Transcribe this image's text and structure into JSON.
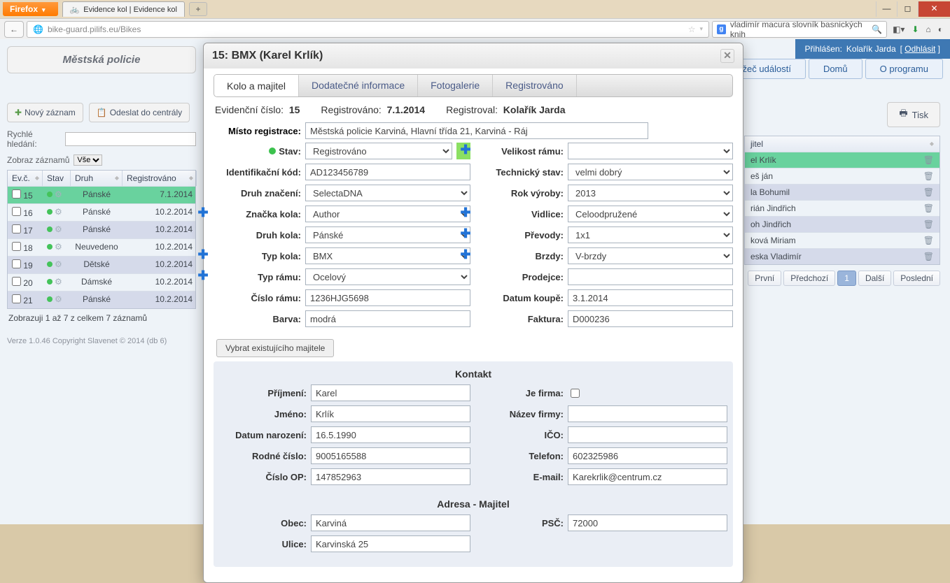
{
  "browser": {
    "firefox": "Firefox",
    "tab_title": "Evidence kol | Evidence kol",
    "url": "bike-guard.pilifs.eu/Bikes",
    "search_text": "vladimír macura slovník basnických knih"
  },
  "header": {
    "logged_in_label": "Přihlášen:",
    "user": "Kolařík Jarda",
    "logout": "Odhlásit",
    "nav": {
      "events": "hlížeč událostí",
      "home": "Domů",
      "about": "O programu"
    }
  },
  "left": {
    "title": "Městská policie",
    "new_record": "Nový záznam",
    "send_central": "Odeslat do centrály",
    "quick_search_label": "Rychlé hledání:",
    "show_records_label": "Zobraz záznamů",
    "show_records_value": "Vše",
    "cols": {
      "evc": "Ev.č.",
      "stav": "Stav",
      "druh": "Druh",
      "reg": "Registrováno"
    },
    "rows": [
      {
        "n": "15",
        "druh": "Pánské",
        "date": "7.1.2014",
        "sel": true
      },
      {
        "n": "16",
        "druh": "Pánské",
        "date": "10.2.2014"
      },
      {
        "n": "17",
        "druh": "Pánské",
        "date": "10.2.2014",
        "alt": true
      },
      {
        "n": "18",
        "druh": "Neuvedeno",
        "date": "10.2.2014"
      },
      {
        "n": "19",
        "druh": "Dětské",
        "date": "10.2.2014",
        "alt": true
      },
      {
        "n": "20",
        "druh": "Dámské",
        "date": "10.2.2014"
      },
      {
        "n": "21",
        "druh": "Pánské",
        "date": "10.2.2014",
        "alt": true
      }
    ],
    "footer": "Zobrazuji 1 až 7 z celkem 7 záznamů",
    "version": "Verze 1.0.46 Copyright Slavenet © 2014 (db 6)"
  },
  "right": {
    "print": "Tisk",
    "owner_col": "jitel",
    "owners": [
      {
        "name": "el Krlík",
        "sel": true
      },
      {
        "name": "eš ján"
      },
      {
        "name": "la Bohumil",
        "alt": true
      },
      {
        "name": "rián Jindřich"
      },
      {
        "name": "oh Jindřich",
        "alt": true
      },
      {
        "name": "ková Miriam"
      },
      {
        "name": "eska Vladimír",
        "alt": true
      }
    ],
    "pager": {
      "first": "První",
      "prev": "Předchozí",
      "page": "1",
      "next": "Další",
      "last": "Poslední"
    }
  },
  "modal": {
    "title": "15: BMX (Karel Krlík)",
    "tabs": {
      "t1": "Kolo a majitel",
      "t2": "Dodatečné informace",
      "t3": "Fotogalerie",
      "t4": "Registrováno"
    },
    "info": {
      "evlabel": "Evidenční číslo:",
      "evval": "15",
      "reglabel": "Registrováno:",
      "regval": "7.1.2014",
      "bylabel": "Registroval:",
      "byval": "Kolařík Jarda"
    },
    "labels": {
      "misto": "Místo registrace:",
      "stav": "Stav:",
      "idkod": "Identifikační kód:",
      "znaceni": "Druh značení:",
      "znacka": "Značka kola:",
      "druhkola": "Druh kola:",
      "typkola": "Typ kola:",
      "typramu": "Typ rámu:",
      "cisloramu": "Číslo rámu:",
      "barva": "Barva:",
      "velikost": "Velikost rámu:",
      "techstav": "Technický stav:",
      "rokvyroby": "Rok výroby:",
      "vidlice": "Vidlice:",
      "prevody": "Převody:",
      "brzdy": "Brzdy:",
      "prodejce": "Prodejce:",
      "datumkoupe": "Datum koupě:",
      "faktura": "Faktura:"
    },
    "values": {
      "misto": "Městská policie Karviná, Hlavní třída 21, Karviná - Ráj",
      "stav": "Registrováno",
      "idkod": "AD123456789",
      "znaceni": "SelectaDNA",
      "znacka": "Author",
      "druhkola": "Pánské",
      "typkola": "BMX",
      "typramu": "Ocelový",
      "cisloramu": "1236HJG5698",
      "barva": "modrá",
      "velikost": "",
      "techstav": "velmi dobrý",
      "rokvyroby": "2013",
      "vidlice": "Celoodpružené",
      "prevody": "1x1",
      "brzdy": "V-brzdy",
      "prodejce": "",
      "datumkoupe": "3.1.2014",
      "faktura": "D000236"
    },
    "select_owner": "Vybrat existujícího majitele",
    "contact_title": "Kontakt",
    "contact_labels": {
      "prijmeni": "Příjmení:",
      "jmeno": "Jméno:",
      "narozeni": "Datum narození:",
      "rodne": "Rodné číslo:",
      "op": "Číslo OP:",
      "firma": "Je firma:",
      "nazev": "Název firmy:",
      "ico": "IČO:",
      "telefon": "Telefon:",
      "email": "E-mail:"
    },
    "contact": {
      "prijmeni": "Karel",
      "jmeno": "Krlík",
      "narozeni": "16.5.1990",
      "rodne": "9005165588",
      "op": "147852963",
      "nazev": "",
      "ico": "",
      "telefon": "602325986",
      "email": "Karekrlik@centrum.cz"
    },
    "address_title": "Adresa - Majitel",
    "address_labels": {
      "obec": "Obec:",
      "psc": "PSČ:",
      "ulice": "Ulice:"
    },
    "address": {
      "obec": "Karviná",
      "psc": "72000",
      "ulice": "Karvinská 25"
    }
  }
}
